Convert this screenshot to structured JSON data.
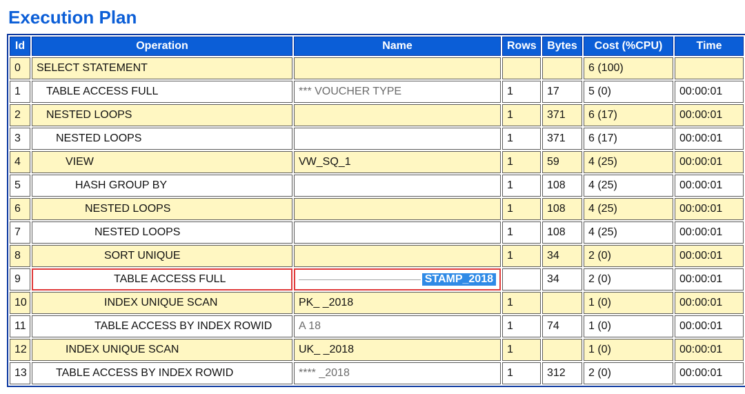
{
  "title": "Execution Plan",
  "columns": {
    "id": "Id",
    "operation": "Operation",
    "name": "Name",
    "rows": "Rows",
    "bytes": "Bytes",
    "cost": "Cost (%CPU)",
    "time": "Time"
  },
  "rows": [
    {
      "id": "0",
      "indent": 0,
      "operation": "SELECT STATEMENT",
      "name": "",
      "rows": "",
      "bytes": "",
      "cost": "6 (100)",
      "time": "",
      "alt": true
    },
    {
      "id": "1",
      "indent": 1,
      "operation": "TABLE ACCESS FULL",
      "name": "*** VOUCHER TYPE",
      "rows": "1",
      "bytes": "17",
      "cost": "5 (0)",
      "time": "00:00:01",
      "alt": false
    },
    {
      "id": "2",
      "indent": 1,
      "operation": "NESTED LOOPS",
      "name": "",
      "rows": "1",
      "bytes": "371",
      "cost": "6 (17)",
      "time": "00:00:01",
      "alt": true
    },
    {
      "id": "3",
      "indent": 2,
      "operation": "NESTED LOOPS",
      "name": "",
      "rows": "1",
      "bytes": "371",
      "cost": "6 (17)",
      "time": "00:00:01",
      "alt": false
    },
    {
      "id": "4",
      "indent": 3,
      "operation": "VIEW",
      "name": "VW_SQ_1",
      "rows": "1",
      "bytes": "59",
      "cost": "4 (25)",
      "time": "00:00:01",
      "alt": true
    },
    {
      "id": "5",
      "indent": 4,
      "operation": "HASH GROUP BY",
      "name": "",
      "rows": "1",
      "bytes": "108",
      "cost": "4 (25)",
      "time": "00:00:01",
      "alt": false
    },
    {
      "id": "6",
      "indent": 5,
      "operation": "NESTED LOOPS",
      "name": "",
      "rows": "1",
      "bytes": "108",
      "cost": "4 (25)",
      "time": "00:00:01",
      "alt": true
    },
    {
      "id": "7",
      "indent": 6,
      "operation": "NESTED LOOPS",
      "name": "",
      "rows": "1",
      "bytes": "108",
      "cost": "4 (25)",
      "time": "00:00:01",
      "alt": false
    },
    {
      "id": "8",
      "indent": 7,
      "operation": "SORT UNIQUE",
      "name": "",
      "rows": "1",
      "bytes": "34",
      "cost": "2 (0)",
      "time": "00:00:01",
      "alt": true
    },
    {
      "id": "9",
      "indent": 8,
      "operation": "TABLE ACCESS FULL",
      "name": "STAMP_2018",
      "rows": "",
      "bytes": "34",
      "cost": "2 (0)",
      "time": "00:00:01",
      "alt": false,
      "highlighted": true
    },
    {
      "id": "10",
      "indent": 7,
      "operation": "INDEX UNIQUE SCAN",
      "name": "PK_           _2018",
      "rows": "1",
      "bytes": "",
      "cost": "1 (0)",
      "time": "00:00:01",
      "alt": true
    },
    {
      "id": "11",
      "indent": 6,
      "operation": "TABLE ACCESS BY INDEX ROWID",
      "name": "A             18",
      "rows": "1",
      "bytes": "74",
      "cost": "1 (0)",
      "time": "00:00:01",
      "alt": false
    },
    {
      "id": "12",
      "indent": 3,
      "operation": "INDEX UNIQUE SCAN",
      "name": "UK_            _2018",
      "rows": "1",
      "bytes": "",
      "cost": "1 (0)",
      "time": "00:00:01",
      "alt": true
    },
    {
      "id": "13",
      "indent": 2,
      "operation": "TABLE ACCESS BY INDEX ROWID",
      "name": "****        _2018",
      "rows": "1",
      "bytes": "312",
      "cost": "2 (0)",
      "time": "00:00:01",
      "alt": false
    }
  ],
  "highlight_chip_text": "STAMP_2018"
}
